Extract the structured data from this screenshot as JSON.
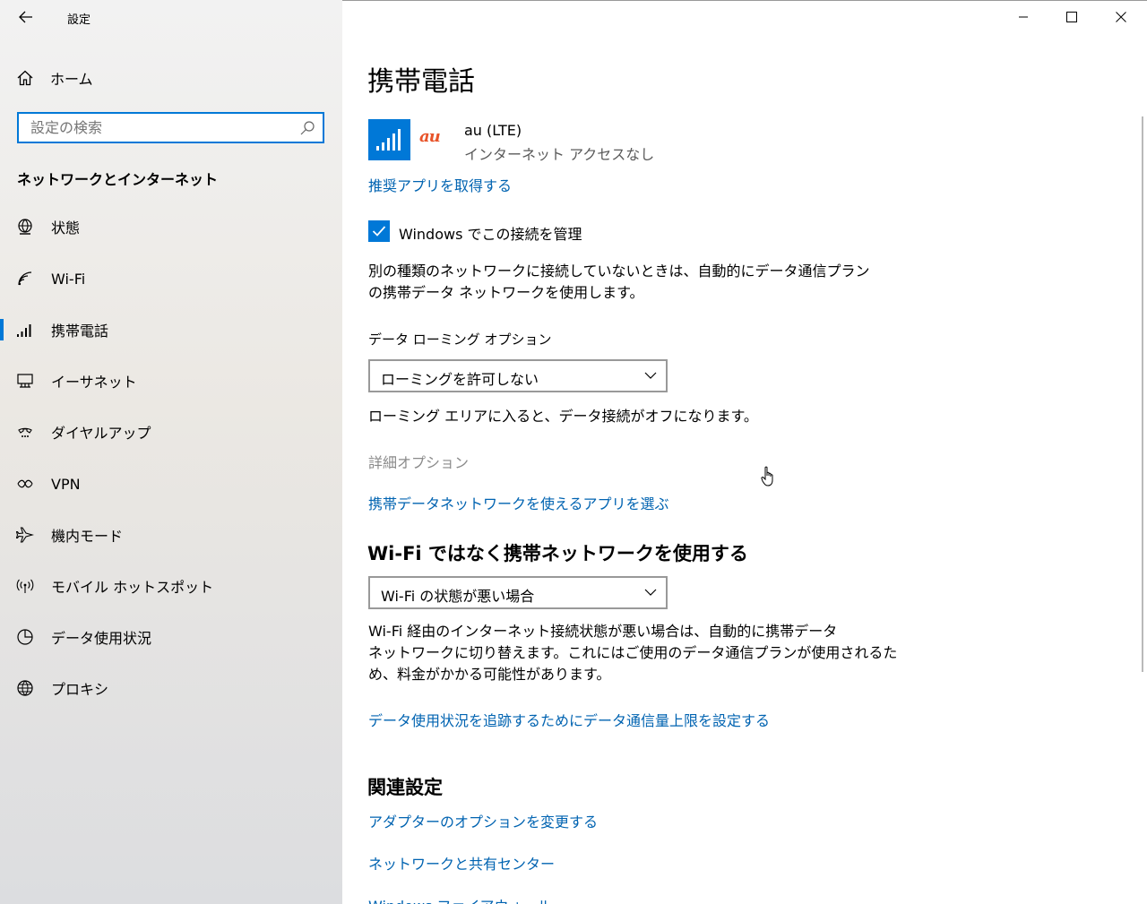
{
  "window": {
    "title": "設定"
  },
  "sidebar": {
    "home_label": "ホーム",
    "search_placeholder": "設定の検索",
    "section_title": "ネットワークとインターネット",
    "items": [
      {
        "label": "状態",
        "icon": "globe-status-icon"
      },
      {
        "label": "Wi-Fi",
        "icon": "wifi-icon"
      },
      {
        "label": "携帯電話",
        "icon": "cellular-icon",
        "selected": true
      },
      {
        "label": "イーサネット",
        "icon": "ethernet-icon"
      },
      {
        "label": "ダイヤルアップ",
        "icon": "dialup-icon"
      },
      {
        "label": "VPN",
        "icon": "vpn-icon"
      },
      {
        "label": "機内モード",
        "icon": "airplane-icon"
      },
      {
        "label": "モバイル ホットスポット",
        "icon": "hotspot-icon"
      },
      {
        "label": "データ使用状況",
        "icon": "data-usage-icon"
      },
      {
        "label": "プロキシ",
        "icon": "globe-icon"
      }
    ]
  },
  "main": {
    "title": "携帯電話",
    "carrier": {
      "logo_text": "au",
      "name": "au (LTE)",
      "status": "インターネット アクセスなし"
    },
    "get_apps_link": "推奨アプリを取得する",
    "manage_checkbox": {
      "label": "Windows でこの接続を管理",
      "checked": true
    },
    "manage_desc_line1": "別の種類のネットワークに接続していないときは、自動的にデータ通信プラン",
    "manage_desc_line2": "の携帯データ ネットワークを使用します。",
    "roaming": {
      "label": "データ ローミング オプション",
      "selected": "ローミングを許可しない",
      "desc": "ローミング エリアに入ると、データ接続がオフになります。"
    },
    "advanced_options": "詳細オプション",
    "choose_apps_link": "携帯データネットワークを使えるアプリを選ぶ",
    "cellular_over_wifi": {
      "heading": "Wi-Fi ではなく携帯ネットワークを使用する",
      "selected": "Wi-Fi の状態が悪い場合",
      "desc_line1": "Wi-Fi 経由のインターネット接続状態が悪い場合は、自動的に携帯データ",
      "desc_line2": "ネットワークに切り替えます。これにはご使用のデータ通信プランが使用されるた",
      "desc_line3": "め、料金がかかる可能性があります。"
    },
    "data_limit_link": "データ使用状況を追跡するためにデータ通信量上限を設定する",
    "related": {
      "heading": "関連設定",
      "links": [
        "アダプターのオプションを変更する",
        "ネットワークと共有センター",
        "Windows ファイアウォール"
      ]
    }
  },
  "colors": {
    "accent": "#0078d7",
    "link": "#0063b1",
    "au_brand": "#e8542a"
  }
}
